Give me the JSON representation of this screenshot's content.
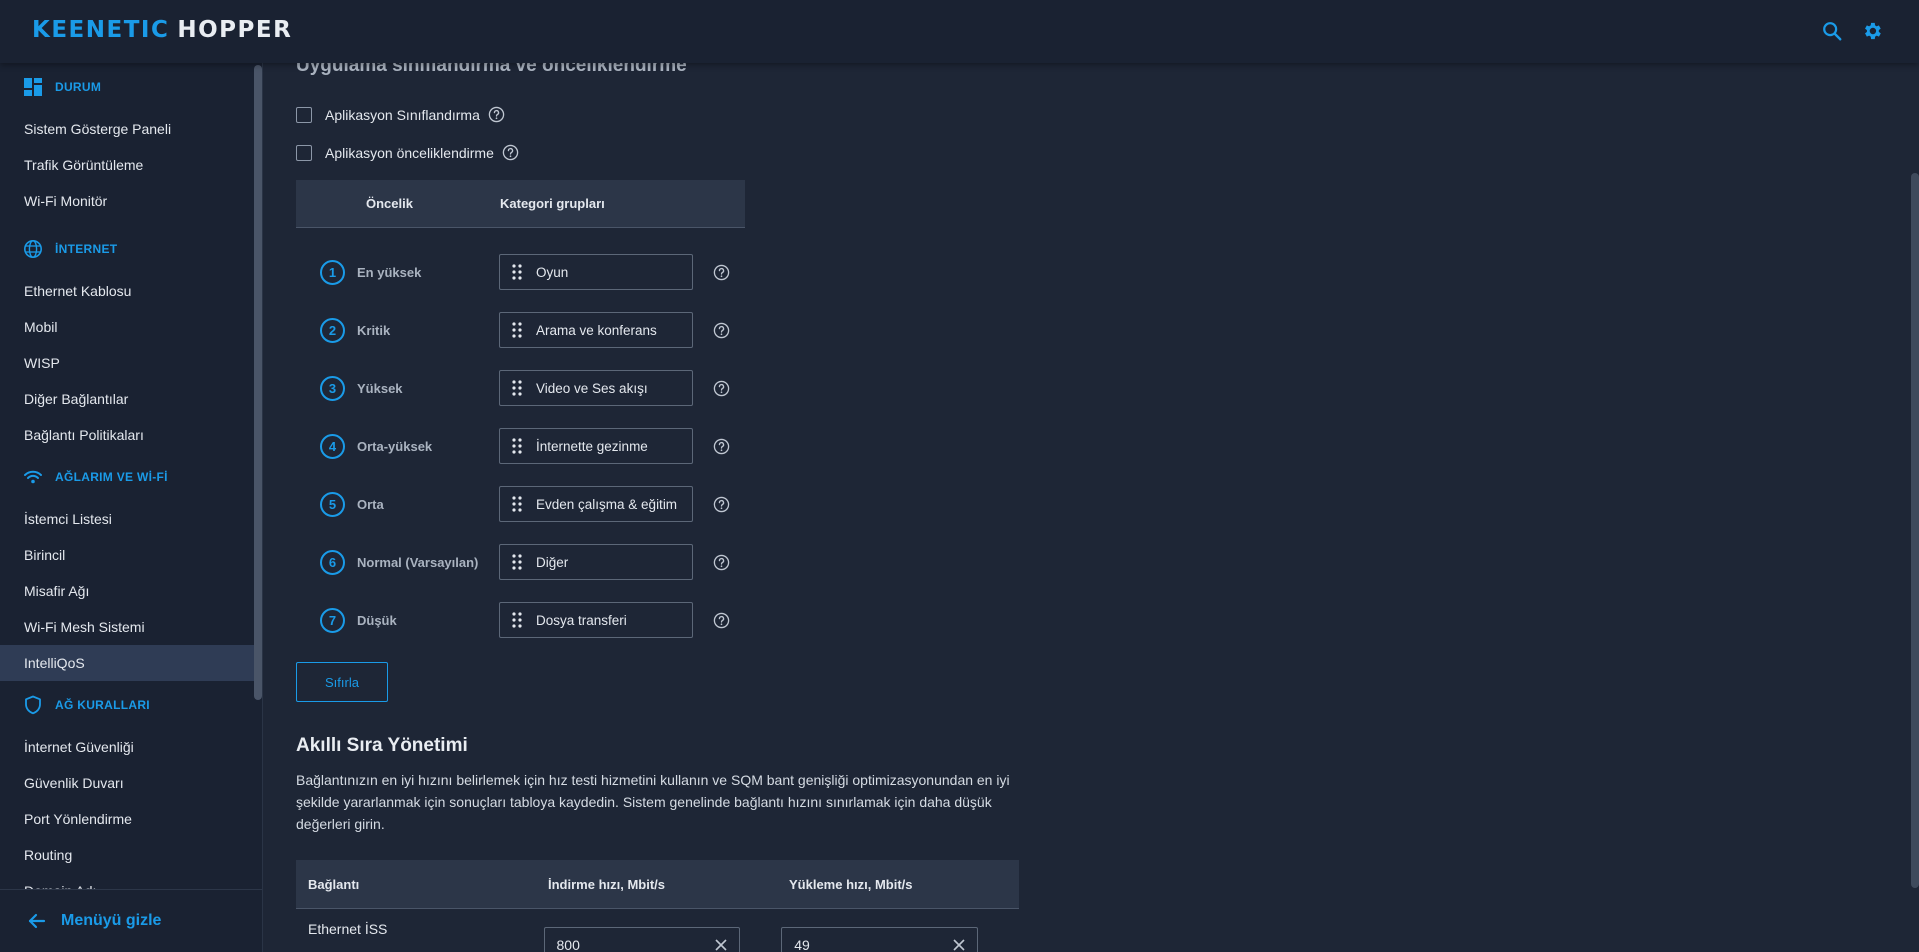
{
  "header": {
    "brand": "KEENETIC",
    "model": "HOPPER",
    "search_icon": "search-icon",
    "settings_icon": "gear-icon",
    "accent": "#1a9be8"
  },
  "sidebar": {
    "sections": [
      {
        "label": "DURUM",
        "icon": "dashboard-icon",
        "items": [
          "Sistem Gösterge Paneli",
          "Trafik Görüntüleme",
          "Wi-Fi Monitör"
        ]
      },
      {
        "label": "İNTERNET",
        "icon": "globe-icon",
        "items": [
          "Ethernet Kablosu",
          "Mobil",
          "WISP",
          "Diğer Bağlantılar",
          "Bağlantı Politikaları"
        ]
      },
      {
        "label": "AĞLARIM VE Wİ-Fİ",
        "icon": "wifi-icon",
        "items": [
          "İstemci Listesi",
          "Birincil",
          "Misafir Ağı",
          "Wi-Fi Mesh Sistemi",
          "IntelliQoS"
        ]
      },
      {
        "label": "AĞ KURALLARI",
        "icon": "shield-icon",
        "items": [
          "İnternet Güvenliği",
          "Güvenlik Duvarı",
          "Port Yönlendirme",
          "Routing",
          "Domain Adı"
        ]
      }
    ],
    "active_item": "IntelliQoS",
    "footer_label": "Menüyü gizle"
  },
  "main": {
    "section_title": "Uygulama sınıflandırma ve önceliklendirme",
    "checkbox_classification": "Aplikasyon Sınıflandırma",
    "checkbox_prioritization": "Aplikasyon önceliklendirme",
    "priority_table": {
      "col_priority": "Öncelik",
      "col_groups": "Kategori grupları",
      "rows": [
        {
          "num": "1",
          "label": "En yüksek",
          "category": "Oyun"
        },
        {
          "num": "2",
          "label": "Kritik",
          "category": "Arama ve konferans"
        },
        {
          "num": "3",
          "label": "Yüksek",
          "category": "Video ve Ses akışı"
        },
        {
          "num": "4",
          "label": "Orta-yüksek",
          "category": "İnternette gezinme"
        },
        {
          "num": "5",
          "label": "Orta",
          "category": "Evden çalışma & eğitim"
        },
        {
          "num": "6",
          "label": "Normal (Varsayılan)",
          "category": "Diğer"
        },
        {
          "num": "7",
          "label": "Düşük",
          "category": "Dosya transferi"
        }
      ]
    },
    "reset_label": "Sıfırla",
    "sqm": {
      "title": "Akıllı Sıra Yönetimi",
      "description": "Bağlantınızın en iyi hızını belirlemek için hız testi hizmetini kullanın ve SQM bant genişliği optimizasyonundan en iyi şekilde yararlanmak için sonuçları tabloya kaydedin. Sistem genelinde bağlantı hızını sınırlamak için daha düşük değerleri girin.",
      "col_connection": "Bağlantı",
      "col_download": "İndirme hızı, Mbit/s",
      "col_upload": "Yükleme hızı, Mbit/s",
      "rows": [
        {
          "connection": "Ethernet İSS",
          "download": "800",
          "upload": "49"
        }
      ]
    }
  }
}
